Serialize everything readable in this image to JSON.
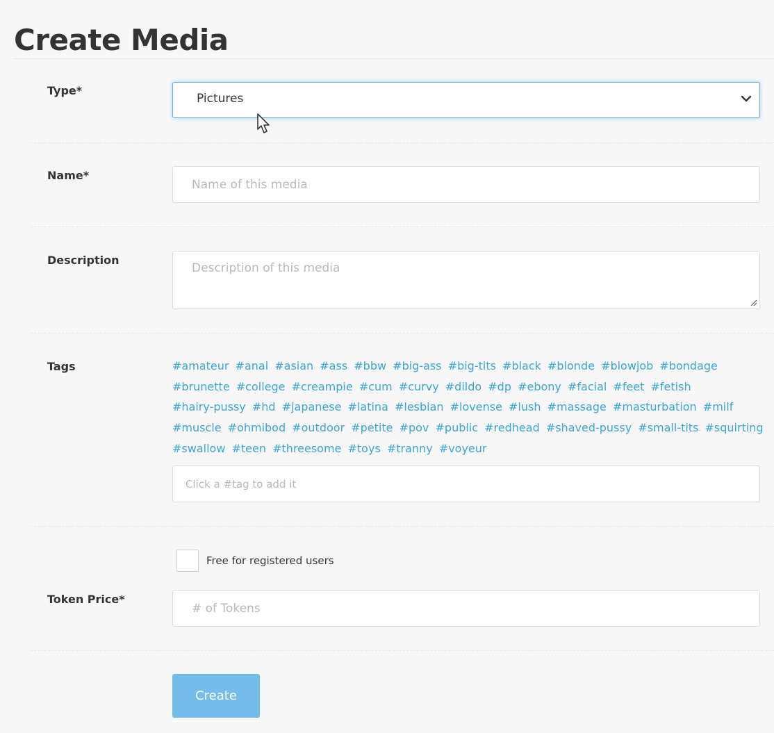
{
  "page": {
    "title": "Create Media"
  },
  "form": {
    "type": {
      "label": "Type*",
      "selected": "Pictures"
    },
    "name": {
      "label": "Name*",
      "placeholder": "Name of this media",
      "value": ""
    },
    "description": {
      "label": "Description",
      "placeholder": "Description of this media",
      "value": ""
    },
    "tags": {
      "label": "Tags",
      "available": [
        "#amateur",
        "#anal",
        "#asian",
        "#ass",
        "#bbw",
        "#big-ass",
        "#big-tits",
        "#black",
        "#blonde",
        "#blowjob",
        "#bondage",
        "#brunette",
        "#college",
        "#creampie",
        "#cum",
        "#curvy",
        "#dildo",
        "#dp",
        "#ebony",
        "#facial",
        "#feet",
        "#fetish",
        "#hairy-pussy",
        "#hd",
        "#japanese",
        "#latina",
        "#lesbian",
        "#lovense",
        "#lush",
        "#massage",
        "#masturbation",
        "#milf",
        "#muscle",
        "#ohmibod",
        "#outdoor",
        "#petite",
        "#pov",
        "#public",
        "#redhead",
        "#shaved-pussy",
        "#small-tits",
        "#squirting",
        "#swallow",
        "#teen",
        "#threesome",
        "#toys",
        "#tranny",
        "#voyeur"
      ],
      "input_placeholder": "Click a #tag to add it",
      "value": ""
    },
    "free_for_registered": {
      "label": "Free for registered users",
      "checked": false
    },
    "token_price": {
      "label": "Token Price*",
      "placeholder": "# of Tokens",
      "value": ""
    },
    "submit_label": "Create"
  },
  "colors": {
    "tag_link": "#3aa6d8",
    "primary_button": "#74bce9",
    "focus_border": "#66afe9"
  }
}
